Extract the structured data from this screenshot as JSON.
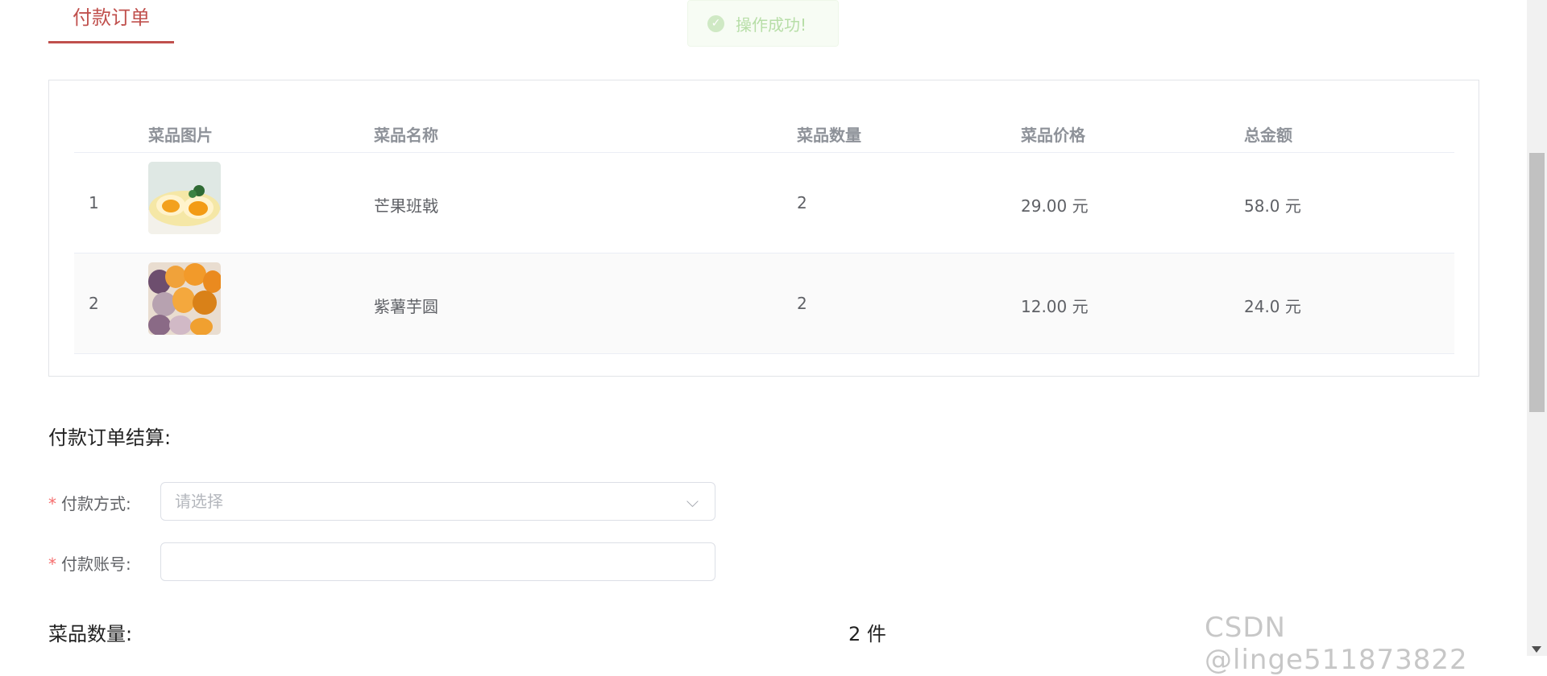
{
  "tab": {
    "label": "付款订单"
  },
  "toast": {
    "text": "操作成功!"
  },
  "table": {
    "headers": [
      "菜品图片",
      "菜品名称",
      "菜品数量",
      "菜品价格",
      "总金额"
    ],
    "rows": [
      {
        "index": "1",
        "name": "芒果班戟",
        "qty": "2",
        "price": "29.00 元",
        "total": "58.0 元"
      },
      {
        "index": "2",
        "name": "紫薯芋圆",
        "qty": "2",
        "price": "12.00 元",
        "total": "24.0 元"
      }
    ]
  },
  "checkout": {
    "title": "付款订单结算:",
    "payment_method_label": "付款方式:",
    "payment_method_placeholder": "请选择",
    "account_label": "付款账号:",
    "account_value": "",
    "qty_label": "菜品数量:",
    "qty_value": "2 件"
  },
  "watermark": "CSDN @linge511873822",
  "colors": {
    "accent": "#c0504d",
    "required": "#f56c6c",
    "success": "#b7dea7"
  }
}
